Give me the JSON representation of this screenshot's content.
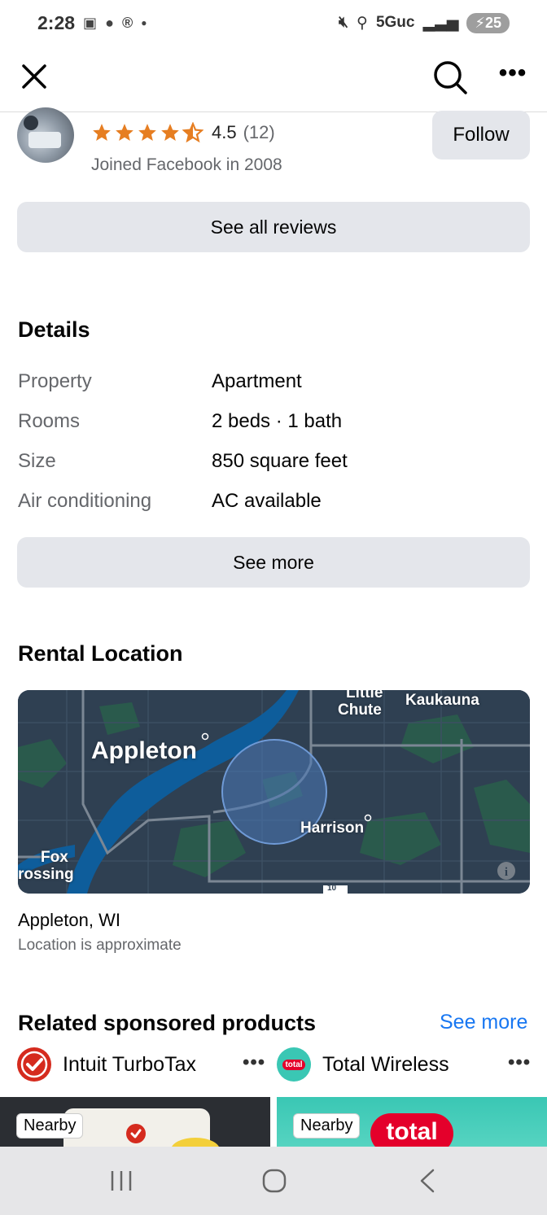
{
  "status": {
    "time": "2:28",
    "network": "5Guc",
    "battery": "25"
  },
  "seller": {
    "rating": "4.5",
    "rating_count": "(12)",
    "joined": "Joined Facebook in 2008",
    "follow_label": "Follow"
  },
  "reviews_button": "See all reviews",
  "details": {
    "title": "Details",
    "rows": [
      {
        "key": "Property",
        "value": "Apartment"
      },
      {
        "key": "Rooms",
        "value": "2 beds · 1 bath"
      },
      {
        "key": "Size",
        "value": "850 square feet"
      },
      {
        "key": "Air conditioning",
        "value": "AC available"
      }
    ],
    "see_more": "See more"
  },
  "location": {
    "title": "Rental Location",
    "map_labels": {
      "appleton": "Appleton",
      "little": "Little",
      "chute": "Chute",
      "kaukauna": "Kaukauna",
      "harrison": "Harrison",
      "fox": "Fox",
      "crossing": "rossing",
      "highway": "10"
    },
    "name": "Appleton, WI",
    "note": "Location is approximate"
  },
  "related": {
    "title": "Related sponsored products",
    "see_more": "See more",
    "sponsors": [
      {
        "name": "Intuit TurboTax"
      },
      {
        "name": "Total Wireless",
        "logo_text": "total"
      }
    ],
    "card_badge": "Nearby",
    "card_brand": "total"
  },
  "colors": {
    "accent": "#1877f2",
    "star": "#e67e22",
    "button_bg": "#e4e6eb"
  }
}
